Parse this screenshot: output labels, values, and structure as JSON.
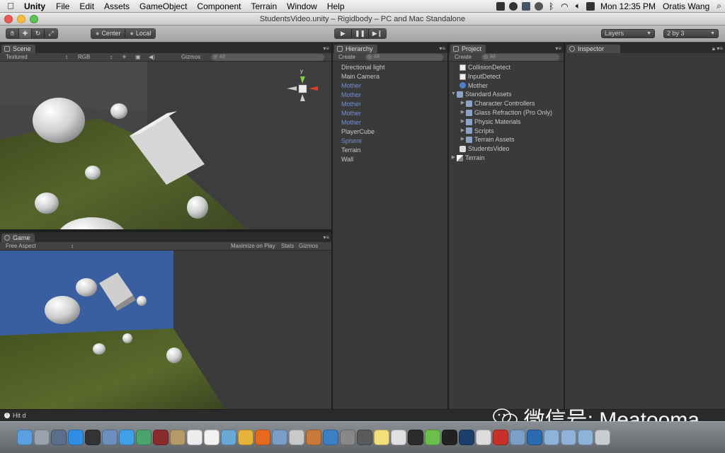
{
  "menubar": {
    "app": "Unity",
    "items": [
      "File",
      "Edit",
      "Assets",
      "GameObject",
      "Component",
      "Terrain",
      "Window",
      "Help"
    ],
    "clock": "Mon 12:35 PM",
    "user": "Oratis Wang"
  },
  "window": {
    "title": "StudentsVideo.unity – Rigidbody – PC and Mac Standalone"
  },
  "toolbar": {
    "pivot_label": "Center",
    "space_label": "Local",
    "layers_label": "Layers",
    "layout_label": "2 by 3"
  },
  "scene": {
    "tab": "Scene",
    "render_mode": "Textured",
    "color_mode": "RGB",
    "gizmos": "Gizmos",
    "search": "All",
    "axis_label": "y"
  },
  "game": {
    "tab": "Game",
    "aspect": "Free Aspect",
    "maximize": "Maximize on Play",
    "stats": "Stats",
    "gizmos": "Gizmos"
  },
  "hierarchy": {
    "tab": "Hierarchy",
    "create": "Create",
    "search": "All",
    "items": [
      {
        "label": "Directional light",
        "prefab": false
      },
      {
        "label": "Main Camera",
        "prefab": false
      },
      {
        "label": "Mother",
        "prefab": true
      },
      {
        "label": "Mother",
        "prefab": true
      },
      {
        "label": "Mother",
        "prefab": true
      },
      {
        "label": "Mother",
        "prefab": true
      },
      {
        "label": "Mother",
        "prefab": true
      },
      {
        "label": "PlayerCube",
        "prefab": false
      },
      {
        "label": "Sphere",
        "prefab": true
      },
      {
        "label": "Terrain",
        "prefab": false
      },
      {
        "label": "Wall",
        "prefab": false
      }
    ]
  },
  "project": {
    "tab": "Project",
    "create": "Create",
    "search": "All",
    "items": [
      {
        "label": "CollisionDetect",
        "icon": "script",
        "indent": 1,
        "expander": ""
      },
      {
        "label": "InputDetect",
        "icon": "script",
        "indent": 1,
        "expander": ""
      },
      {
        "label": "Mother",
        "icon": "prefab",
        "indent": 1,
        "expander": ""
      },
      {
        "label": "Standard Assets",
        "icon": "folder",
        "indent": 0,
        "expander": "▼"
      },
      {
        "label": "Character Controllers",
        "icon": "folder",
        "indent": 1,
        "expander": "▶"
      },
      {
        "label": "Glass Refraction (Pro Only)",
        "icon": "folder",
        "indent": 1,
        "expander": "▶"
      },
      {
        "label": "Physic Materials",
        "icon": "folder",
        "indent": 1,
        "expander": "▶"
      },
      {
        "label": "Scripts",
        "icon": "folder",
        "indent": 1,
        "expander": "▶"
      },
      {
        "label": "Terrain Assets",
        "icon": "folder",
        "indent": 1,
        "expander": "▶"
      },
      {
        "label": "StudentsVideo",
        "icon": "scene",
        "indent": 1,
        "expander": ""
      },
      {
        "label": "Terrain",
        "icon": "terrain",
        "indent": 0,
        "expander": "▶"
      }
    ]
  },
  "inspector": {
    "tab": "Inspector"
  },
  "status": {
    "message": "Hit d"
  },
  "watermark": {
    "text": "微信号: Meatooma"
  },
  "dock": {
    "icons": [
      "finder-icon",
      "launchpad-icon",
      "mission-control-icon",
      "app-store-icon",
      "dashboard-icon",
      "preview-icon",
      "safari-icon",
      "facetime-icon",
      "photo-booth-icon",
      "contacts-icon",
      "calendar-icon",
      "reminders-icon",
      "itunes-icon",
      "chrome-icon",
      "firefox-icon",
      "preview2-icon",
      "tools-icon",
      "guitar-icon",
      "xcode-icon",
      "disk-icon",
      "camera-icon",
      "notes-icon",
      "textwrangler-icon",
      "activity-monitor-icon",
      "evernote-icon",
      "qq-icon",
      "photoshop-icon",
      "unity-icon",
      "pdf-icon",
      "network-icon",
      "quicktime-icon",
      "folder-icon",
      "folder2-icon",
      "downloads-icon",
      "trash-icon"
    ],
    "colors": [
      "#5aa0e0",
      "#9aa3ad",
      "#5b6e8a",
      "#2f8de4",
      "#333",
      "#6d8fbd",
      "#3fa0e8",
      "#4aa56a",
      "#8a2c2c",
      "#b69a6a",
      "#ededed",
      "#f2f2f2",
      "#6aa8d8",
      "#e8b33a",
      "#e66a1e",
      "#7a9ec6",
      "#c9c9c9",
      "#c97a3a",
      "#3d7fc4",
      "#888",
      "#5a5a5a",
      "#f3de7a",
      "#e0e0e0",
      "#2b2b2b",
      "#6ac04a",
      "#222",
      "#1b3f6b",
      "#ddd",
      "#c8302a",
      "#7aa0c8",
      "#2a6ab0",
      "#8fb2d8",
      "#8fb2d8",
      "#8fb2d8",
      "#c8cdd2"
    ]
  },
  "colors": {
    "panel_bg": "#3a3a3a",
    "prefab_text": "#6f93d6",
    "sky": "#3a5fa0",
    "terrain": "#4b5a2a"
  }
}
